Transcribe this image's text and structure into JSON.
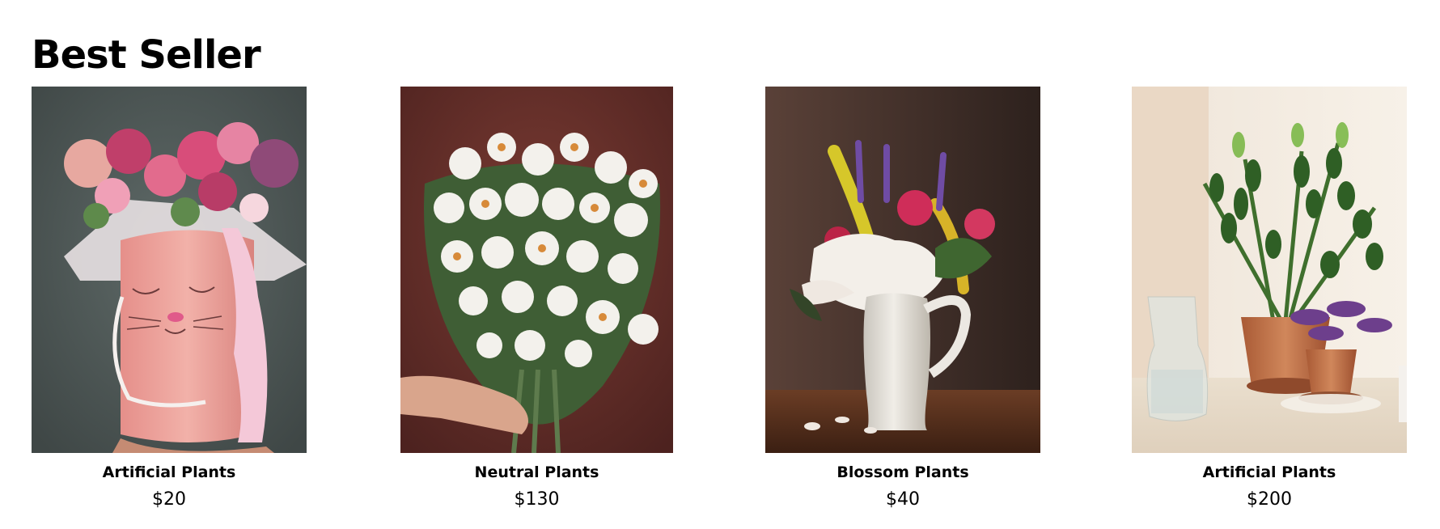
{
  "section": {
    "title": "Best Seller"
  },
  "products": [
    {
      "name": "Artificial Plants",
      "price": "$20",
      "image_icon": "pink-cat-box-bouquet-image"
    },
    {
      "name": "Neutral Plants",
      "price": "$130",
      "image_icon": "white-strawflower-bouquet-image"
    },
    {
      "name": "Blossom Plants",
      "price": "$40",
      "image_icon": "pitcher-flower-arrangement-image"
    },
    {
      "name": "Artificial Plants",
      "price": "$200",
      "image_icon": "potted-houseplants-image"
    }
  ],
  "colors": {
    "background": "#ffffff",
    "text": "#000000"
  }
}
